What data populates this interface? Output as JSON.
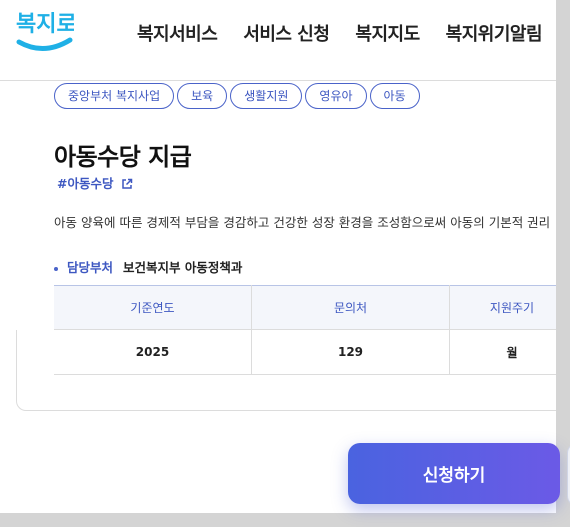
{
  "header": {
    "logo_text": "복지로",
    "nav": [
      "복지서비스",
      "서비스 신청",
      "복지지도",
      "복지위기알림"
    ]
  },
  "tags": [
    "중앙부처 복지사업",
    "보육",
    "생활지원",
    "영유아",
    "아동"
  ],
  "service": {
    "title": "아동수당 지급",
    "hashtag": "#아동수당",
    "description": "아동 양육에 따른 경제적 부담을 경감하고 건강한 성장 환경을 조성함으로써 아동의 기본적 권리",
    "department_label": "담당부처",
    "department": "보건복지부 아동정책과"
  },
  "table": {
    "headers": [
      "기준연도",
      "문의처",
      "지원주기"
    ],
    "row": [
      "2025",
      "129",
      "월"
    ]
  },
  "apply_button": "신청하기",
  "colors": {
    "accent": "#3d57c1",
    "button_start": "#4a63e0",
    "button_end": "#6b5ae6"
  }
}
